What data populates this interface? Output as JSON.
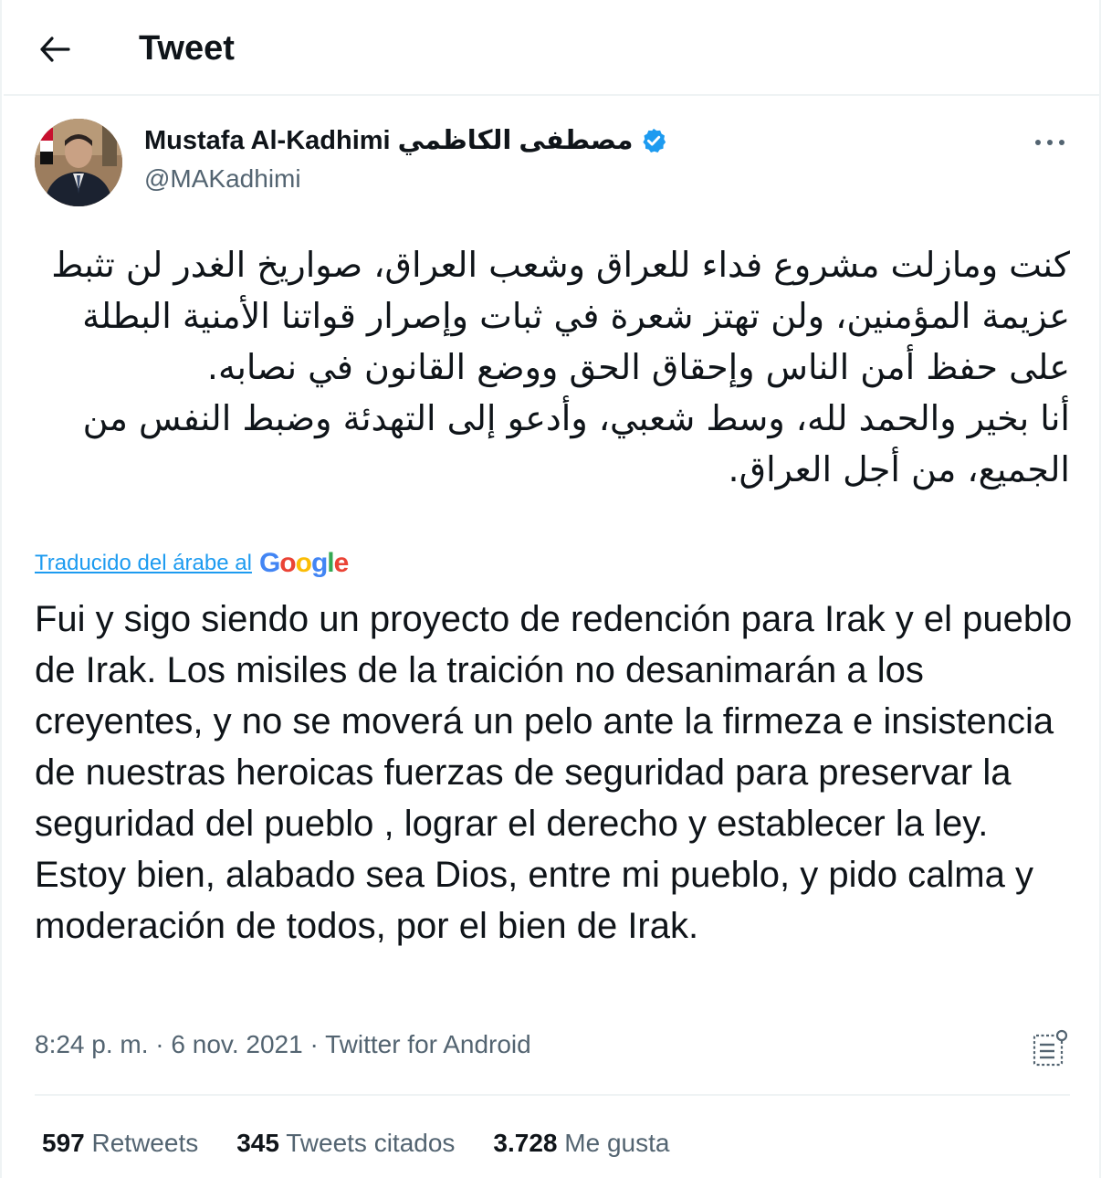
{
  "header": {
    "title": "Tweet",
    "back_icon": "arrow-left-icon"
  },
  "author": {
    "name": "Mustafa Al-Kadhimi مصطفى الكاظمي",
    "handle": "@MAKadhimi",
    "verified_icon": "verified-badge-icon",
    "verified_color": "#1d9bf0"
  },
  "more_icon": "more-horizontal-icon",
  "tweet": {
    "arabic_text": "كنت ومازلت مشروع فداء للعراق وشعب العراق، صواريخ الغدر لن تثبط عزيمة المؤمنين، ولن تهتز شعرة في ثبات وإصرار قواتنا الأمنية البطلة على حفظ أمن الناس وإحقاق الحق ووضع القانون في نصابه.\nأنا بخير والحمد لله، وسط شعبي، وأدعو إلى التهدئة وضبط النفس من الجميع، من أجل العراق.",
    "translated_by_label": "Traducido del árabe al",
    "translator_logo": "Google",
    "translated_text": "Fui y sigo siendo un proyecto de redención para Irak y el pueblo de Irak. Los misiles de la traición no desanimarán a los creyentes, y no se moverá un pelo ante la firmeza e insistencia de nuestras heroicas fuerzas de seguridad para preservar la seguridad del pueblo , lograr el derecho y establecer la ley.\n Estoy bien, alabado sea Dios, entre mi pueblo, y pido calma y moderación de todos, por el bien de Irak.",
    "time": "8:24 p. m.",
    "date": "6 nov. 2021",
    "separator": "·",
    "source": "Twitter for Android",
    "analytics_icon": "analytics-icon"
  },
  "stats": {
    "retweets_count": "597",
    "retweets_label": "Retweets",
    "quotes_count": "345",
    "quotes_label": "Tweets citados",
    "likes_count": "3.728",
    "likes_label": "Me gusta"
  },
  "colors": {
    "text_primary": "#0f1419",
    "text_secondary": "#536471",
    "link": "#1d9bf0",
    "border": "#eff3f4"
  }
}
